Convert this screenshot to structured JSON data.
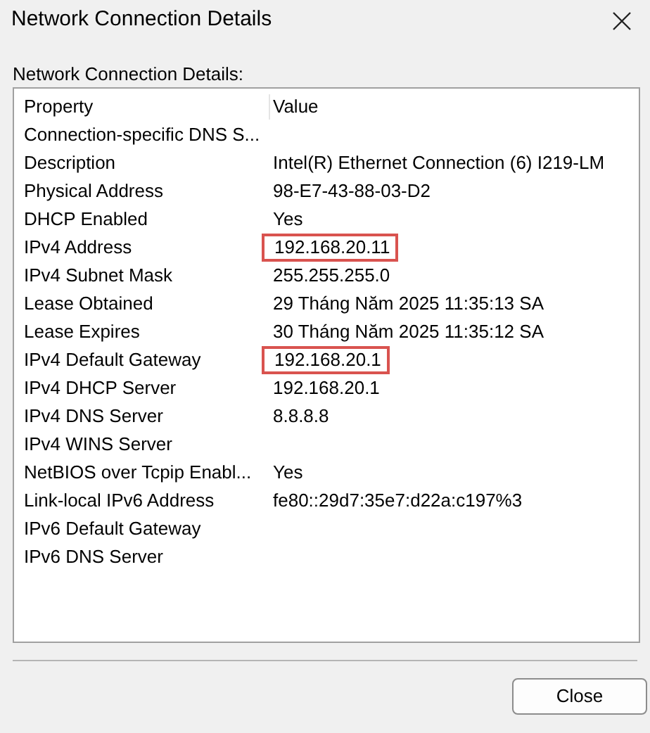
{
  "window": {
    "title": "Network Connection Details"
  },
  "group_label": "Network Connection Details:",
  "table": {
    "columns": [
      "Property",
      "Value"
    ],
    "rows": [
      {
        "property": "Connection-specific DNS S...",
        "value": "",
        "highlighted": false
      },
      {
        "property": "Description",
        "value": "Intel(R) Ethernet Connection (6) I219-LM",
        "highlighted": false
      },
      {
        "property": "Physical Address",
        "value": "98-E7-43-88-03-D2",
        "highlighted": false
      },
      {
        "property": "DHCP Enabled",
        "value": "Yes",
        "highlighted": false
      },
      {
        "property": "IPv4 Address",
        "value": "192.168.20.11",
        "highlighted": true
      },
      {
        "property": "IPv4 Subnet Mask",
        "value": "255.255.255.0",
        "highlighted": false
      },
      {
        "property": "Lease Obtained",
        "value": "29 Tháng Năm 2025 11:35:13 SA",
        "highlighted": false
      },
      {
        "property": "Lease Expires",
        "value": "30 Tháng Năm 2025 11:35:12 SA",
        "highlighted": false
      },
      {
        "property": "IPv4 Default Gateway",
        "value": "192.168.20.1",
        "highlighted": true
      },
      {
        "property": "IPv4 DHCP Server",
        "value": "192.168.20.1",
        "highlighted": false
      },
      {
        "property": "IPv4 DNS Server",
        "value": "8.8.8.8",
        "highlighted": false
      },
      {
        "property": "IPv4 WINS Server",
        "value": "",
        "highlighted": false
      },
      {
        "property": "NetBIOS over Tcpip Enabl...",
        "value": "Yes",
        "highlighted": false
      },
      {
        "property": "Link-local IPv6 Address",
        "value": "fe80::29d7:35e7:d22a:c197%3",
        "highlighted": false
      },
      {
        "property": "IPv6 Default Gateway",
        "value": "",
        "highlighted": false
      },
      {
        "property": "IPv6 DNS Server",
        "value": "",
        "highlighted": false
      }
    ]
  },
  "buttons": [
    "Close"
  ]
}
